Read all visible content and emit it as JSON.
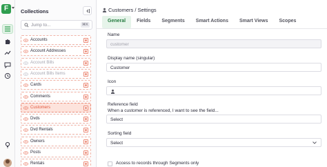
{
  "app": {
    "logo_letter": "F"
  },
  "collections": {
    "title": "Collections",
    "search_placeholder": "Jump to...",
    "search_shortcut": "⌘K",
    "items": [
      {
        "label": "Accounts",
        "state": "normal"
      },
      {
        "label": "Account Addresses",
        "state": "normal"
      },
      {
        "label": "Account Bills",
        "state": "muted"
      },
      {
        "label": "Account Bills Items",
        "state": "muted"
      },
      {
        "label": "Cards",
        "state": "normal"
      },
      {
        "label": "Comments",
        "state": "normal"
      },
      {
        "label": "Customers",
        "state": "active"
      },
      {
        "label": "Dvds",
        "state": "normal"
      },
      {
        "label": "Dvd Rentals",
        "state": "normal"
      },
      {
        "label": "Owners",
        "state": "normal"
      },
      {
        "label": "Posts",
        "state": "normal"
      },
      {
        "label": "Rentals",
        "state": "normal"
      }
    ]
  },
  "main": {
    "breadcrumb": "Customers / Settings",
    "tabs": [
      "General",
      "Fields",
      "Segments",
      "Smart Actions",
      "Smart Views",
      "Scopes"
    ],
    "active_tab": "General",
    "fields": {
      "name_label": "Name",
      "name_value": "customer",
      "display_name_label": "Display name (singular)",
      "display_name_value": "Customer",
      "icon_label": "Icon",
      "reference_label": "Reference field",
      "reference_hint": "When a customer is referenced, I want to see the field...",
      "reference_value": "Select",
      "sorting_label": "Sorting field",
      "sorting_value": "Select",
      "segments_only_label": "Access to records through Segments only"
    }
  },
  "colors": {
    "accent_green": "#2f9e4f",
    "active_collection": "#e2583e"
  }
}
